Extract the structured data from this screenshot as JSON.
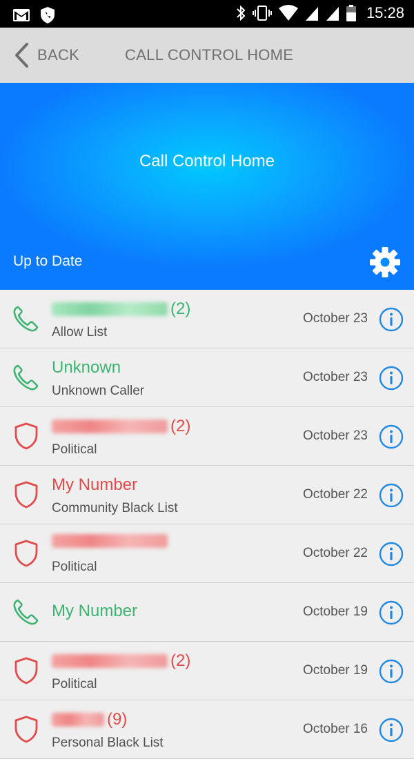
{
  "status_bar": {
    "time": "15:28",
    "left_icons": [
      "gmail-icon",
      "shield-phone-icon"
    ],
    "right_icons": [
      "bluetooth-icon",
      "vibrate-icon",
      "wifi-icon",
      "signal-icon",
      "signal-icon",
      "battery-icon"
    ]
  },
  "toolbar": {
    "back_label": "BACK",
    "title": "CALL CONTROL HOME"
  },
  "hero": {
    "title": "Call Control Home",
    "status": "Up to Date",
    "gear_icon": "gear-icon"
  },
  "colors": {
    "allowed": "#3cb371",
    "blocked": "#e04b4b",
    "info": "#1e88e5",
    "hero_center": "#00c8ff",
    "hero_edge": "#0a7bff"
  },
  "calls": [
    {
      "status": "allowed",
      "icon": "phone-icon",
      "name": "",
      "redacted": true,
      "count": "(2)",
      "subtitle": "Allow List",
      "date": "October 23"
    },
    {
      "status": "allowed",
      "icon": "phone-icon",
      "name": "Unknown",
      "redacted": false,
      "count": "",
      "subtitle": "Unknown Caller",
      "date": "October 23"
    },
    {
      "status": "blocked",
      "icon": "shield-icon",
      "name": "",
      "redacted": true,
      "count": "(2)",
      "subtitle": "Political",
      "date": "October 23"
    },
    {
      "status": "blocked",
      "icon": "shield-icon",
      "name": "My Number",
      "redacted": false,
      "count": "",
      "subtitle": "Community Black List",
      "date": "October 22"
    },
    {
      "status": "blocked",
      "icon": "shield-icon",
      "name": "",
      "redacted": true,
      "count": "",
      "subtitle": "Political",
      "date": "October 22"
    },
    {
      "status": "allowed",
      "icon": "phone-icon",
      "name": "My Number",
      "redacted": false,
      "count": "",
      "subtitle": "",
      "date": "October 19"
    },
    {
      "status": "blocked",
      "icon": "shield-icon",
      "name": "",
      "redacted": true,
      "count": "(2)",
      "subtitle": "Political",
      "date": "October 19"
    },
    {
      "status": "blocked",
      "icon": "shield-icon",
      "name": "",
      "redacted": true,
      "count": "(9)",
      "subtitle": "Personal Black List",
      "date": "October 16"
    }
  ]
}
